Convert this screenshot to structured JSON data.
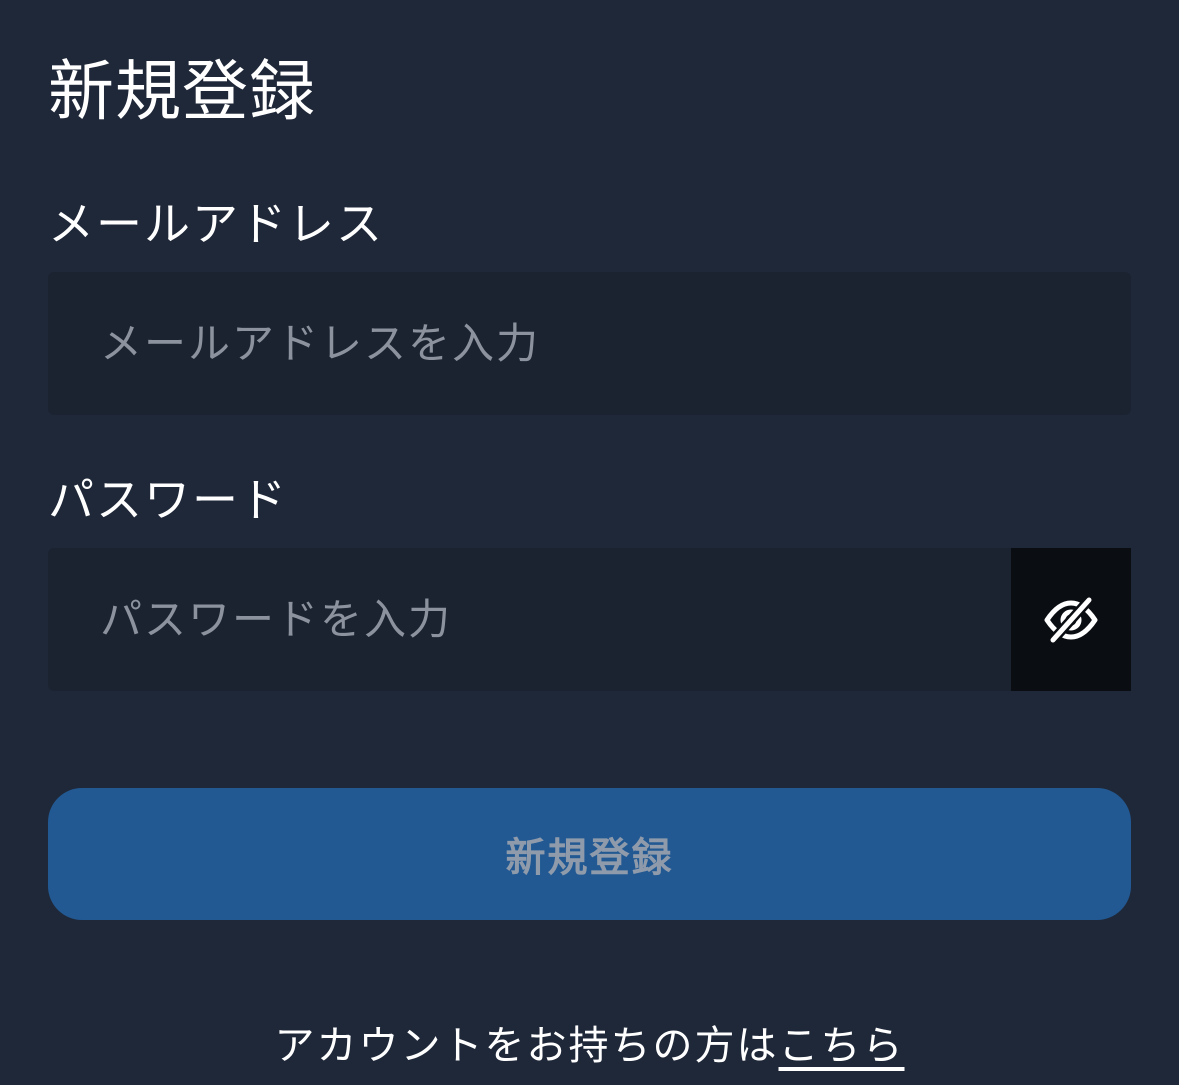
{
  "page": {
    "title": "新規登録"
  },
  "email": {
    "label": "メールアドレス",
    "placeholder": "メールアドレスを入力",
    "value": ""
  },
  "password": {
    "label": "パスワード",
    "placeholder": "パスワードを入力",
    "value": "",
    "toggle_icon": "eye-off-icon"
  },
  "submit": {
    "label": "新規登録",
    "color": "#225993",
    "text_color": "#8f9bab"
  },
  "footer": {
    "prompt": "アカウントをお持ちの方は",
    "link": "こちら"
  },
  "colors": {
    "background": "#1f2839",
    "field_background": "#1b2331",
    "toggle_background": "#0a0d12"
  }
}
